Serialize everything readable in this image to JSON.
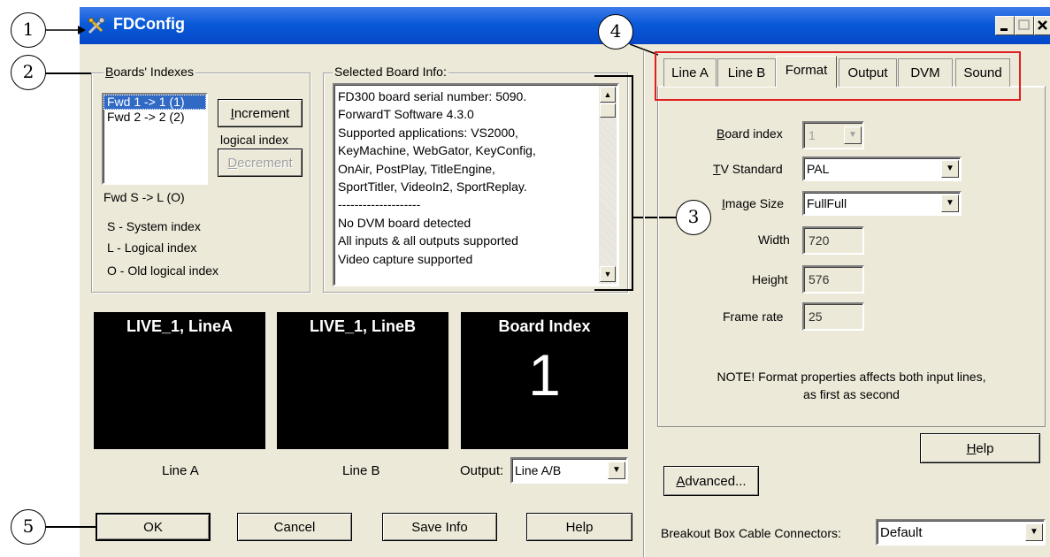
{
  "window": {
    "title": "FDConfig"
  },
  "callouts": [
    "1",
    "2",
    "3",
    "4",
    "5"
  ],
  "boards": {
    "legend": "Boards' Indexes",
    "items": [
      "Fwd 1 -> 1 (1)",
      "Fwd 2 -> 2 (2)"
    ],
    "selected_index": 0,
    "increment_label": "Increment",
    "logical_index_label": "logical index",
    "decrement_label": "Decrement",
    "format_line": "Fwd S -> L (O)",
    "legend_s": "S - System index",
    "legend_l": "L - Logical index",
    "legend_o": "O - Old logical index"
  },
  "info": {
    "legend": "Selected Board Info:",
    "lines": [
      "FD300 board serial number: 5090.",
      "ForwardT Software 4.3.0",
      "Supported applications: VS2000,",
      "KeyMachine, WebGator, KeyConfig,",
      "OnAir, PostPlay, TitleEngine,",
      "SportTitler, VideoIn2, SportReplay.",
      "--------------------",
      "No DVM board detected",
      "All inputs & all outputs supported",
      "Video capture supported"
    ]
  },
  "monitors": {
    "a_title": "LIVE_1, LineA",
    "b_title": "LIVE_1, LineB",
    "index_title": "Board Index",
    "index_value": "1",
    "a_caption": "Line A",
    "b_caption": "Line B",
    "output_label": "Output:",
    "output_value": "Line A/B"
  },
  "buttons": {
    "ok": "OK",
    "cancel": "Cancel",
    "save_info": "Save Info",
    "help": "Help"
  },
  "tabs": [
    "Line A",
    "Line B",
    "Format",
    "Output",
    "DVM",
    "Sound"
  ],
  "active_tab": "Format",
  "format": {
    "board_index_label": "Board index",
    "board_index_value": "1",
    "tv_standard_label": "TV Standard",
    "tv_standard_value": "PAL",
    "image_size_label": "Image Size",
    "image_size_value": "FullFull",
    "width_label": "Width",
    "width_value": "720",
    "height_label": "Height",
    "height_value": "576",
    "frame_rate_label": "Frame rate",
    "frame_rate_value": "25",
    "note_line1": "NOTE! Format properties affects both input lines,",
    "note_line2": "as first as second",
    "help_label": "Help"
  },
  "advanced_label": "Advanced...",
  "breakout": {
    "label": "Breakout Box Cable Connectors:",
    "value": "Default"
  },
  "colors": {
    "titlebar": "#0a5ad8",
    "highlight": "#316ac5",
    "callout_box": "#e02020"
  }
}
